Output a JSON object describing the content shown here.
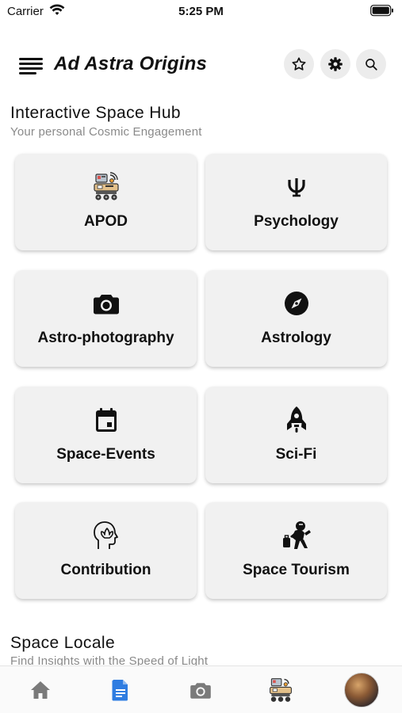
{
  "status_bar": {
    "carrier": "Carrier",
    "time": "5:25 PM"
  },
  "header": {
    "title": "Ad Astra Origins",
    "icons": [
      "menu-icon",
      "star-icon",
      "gear-icon",
      "search-icon"
    ]
  },
  "hub": {
    "title": "Interactive Space Hub",
    "subtitle": "Your personal Cosmic Engagement",
    "cards": [
      {
        "label": "APOD",
        "icon": "rover-icon"
      },
      {
        "label": "Psychology",
        "icon": "psi-icon"
      },
      {
        "label": "Astro-photography",
        "icon": "camera-icon"
      },
      {
        "label": "Astrology",
        "icon": "compass-icon"
      },
      {
        "label": "Space-Events",
        "icon": "calendar-icon"
      },
      {
        "label": "Sci-Fi",
        "icon": "rocket-icon"
      },
      {
        "label": "Contribution",
        "icon": "mind-icon"
      },
      {
        "label": "Space Tourism",
        "icon": "astronaut-icon"
      }
    ]
  },
  "locale": {
    "title": "Space Locale",
    "subtitle": "Find Insights with the Speed of Light"
  },
  "bottom_nav": {
    "items": [
      "home-icon",
      "document-icon",
      "camera-icon",
      "rover-icon",
      "avatar"
    ],
    "active_color": "#2f7de1",
    "inactive_color": "#7a7a7a"
  }
}
